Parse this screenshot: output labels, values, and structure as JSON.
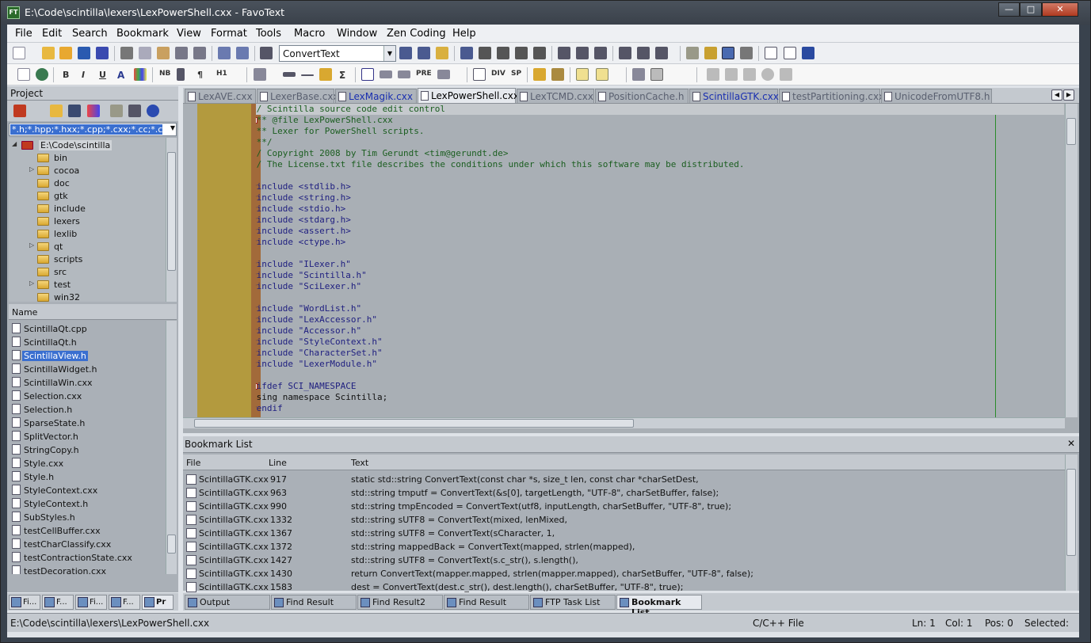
{
  "window": {
    "title": "E:\\Code\\scintilla\\lexers\\LexPowerShell.cxx - FavoText",
    "icon_text": "FT"
  },
  "menu": [
    "File",
    "Edit",
    "Search",
    "Bookmark",
    "View",
    "Format",
    "Tools",
    "Macro",
    "Window",
    "Zen Coding",
    "Help"
  ],
  "toolbar": {
    "combo_value": "ConvertText",
    "text_buttons": [
      "B",
      "I",
      "U",
      "A",
      "NB",
      "¶",
      "H1",
      "PRE",
      "DIV",
      "SP"
    ]
  },
  "project": {
    "title": "Project",
    "filter": "*.h;*.hpp;*.hxx;*.cpp;*.cxx;*.cc;*.c)",
    "root": "E:\\Code\\scintilla",
    "folders": [
      "bin",
      "cocoa",
      "doc",
      "gtk",
      "include",
      "lexers",
      "lexlib",
      "qt",
      "scripts",
      "src",
      "test",
      "win32"
    ],
    "name_header": "Name",
    "files": [
      "ScintillaQt.cpp",
      "ScintillaQt.h",
      "ScintillaView.h",
      "ScintillaWidget.h",
      "ScintillaWin.cxx",
      "Selection.cxx",
      "Selection.h",
      "SparseState.h",
      "SplitVector.h",
      "StringCopy.h",
      "Style.cxx",
      "Style.h",
      "StyleContext.cxx",
      "StyleContext.h",
      "SubStyles.h",
      "testCellBuffer.cxx",
      "testCharClassify.cxx",
      "testContractionState.cxx",
      "testDecoration.cxx"
    ],
    "selected_file": "ScintillaView.h",
    "tabs": [
      "Fi...",
      "F...",
      "Fi...",
      "F...",
      "Pr"
    ]
  },
  "editor_tabs": [
    "LexAVE.cxx",
    "LexerBase.cxx",
    "LexMagik.cxx",
    "LexPowerShell.cxx",
    "LexTCMD.cxx",
    "PositionCache.h",
    "ScintillaGTK.cxx",
    "testPartitioning.cxx",
    "UnicodeFromUTF8.h"
  ],
  "active_tab": "LexPowerShell.cxx",
  "code_lines": [
    "// Scintilla source code edit control",
    "/** @file LexPowerShell.cxx",
    " ** Lexer for PowerShell scripts.",
    " **/",
    "// Copyright 2008 by Tim Gerundt <tim@gerundt.de>",
    "// The License.txt file describes the conditions under which this software may be distributed.",
    "",
    "#include <stdlib.h>",
    "#include <string.h>",
    "#include <stdio.h>",
    "#include <stdarg.h>",
    "#include <assert.h>",
    "#include <ctype.h>",
    "",
    "#include \"ILexer.h\"",
    "#include \"Scintilla.h\"",
    "#include \"SciLexer.h\"",
    "",
    "#include \"WordList.h\"",
    "#include \"LexAccessor.h\"",
    "#include \"Accessor.h\"",
    "#include \"StyleContext.h\"",
    "#include \"CharacterSet.h\"",
    "#include \"LexerModule.h\"",
    "",
    "#ifdef SCI_NAMESPACE",
    "using namespace Scintilla;",
    "#endif"
  ],
  "bookmarks": {
    "title": "Bookmark List",
    "columns": [
      "File",
      "Line",
      "Text"
    ],
    "rows": [
      {
        "file": "ScintillaGTK.cxx",
        "line": "917",
        "text": "static std::string ConvertText(const char *s, size_t len, const char *charSetDest,"
      },
      {
        "file": "ScintillaGTK.cxx",
        "line": "963",
        "text": "std::string tmputf = ConvertText(&s[0], targetLength, \"UTF-8\", charSetBuffer, false);"
      },
      {
        "file": "ScintillaGTK.cxx",
        "line": "990",
        "text": "std::string tmpEncoded = ConvertText(utf8, inputLength, charSetBuffer, \"UTF-8\", true);"
      },
      {
        "file": "ScintillaGTK.cxx",
        "line": "1332",
        "text": "std::string sUTF8 = ConvertText(mixed, lenMixed,"
      },
      {
        "file": "ScintillaGTK.cxx",
        "line": "1367",
        "text": "std::string sUTF8 = ConvertText(sCharacter, 1,"
      },
      {
        "file": "ScintillaGTK.cxx",
        "line": "1372",
        "text": "std::string mappedBack = ConvertText(mapped, strlen(mapped),"
      },
      {
        "file": "ScintillaGTK.cxx",
        "line": "1427",
        "text": "std::string sUTF8 = ConvertText(s.c_str(), s.length(),"
      },
      {
        "file": "ScintillaGTK.cxx",
        "line": "1430",
        "text": "return ConvertText(mapper.mapped, strlen(mapper.mapped), charSetBuffer, \"UTF-8\", false);"
      },
      {
        "file": "ScintillaGTK.cxx",
        "line": "1583",
        "text": "dest = ConvertText(dest.c_str(), dest.length(), charSetBuffer, \"UTF-8\", true);"
      }
    ]
  },
  "bottom_tabs": [
    "Output",
    "Find Result",
    "Find Result2",
    "Find Result",
    "FTP Task List",
    "Bookmark List"
  ],
  "active_bottom_tab": "Bookmark List",
  "status": {
    "path": "E:\\Code\\scintilla\\lexers\\LexPowerShell.cxx",
    "lang": "C/C++ File",
    "ln": "Ln: 1",
    "col": "Col: 1",
    "pos": "Pos: 0",
    "selected": "Selected:"
  }
}
